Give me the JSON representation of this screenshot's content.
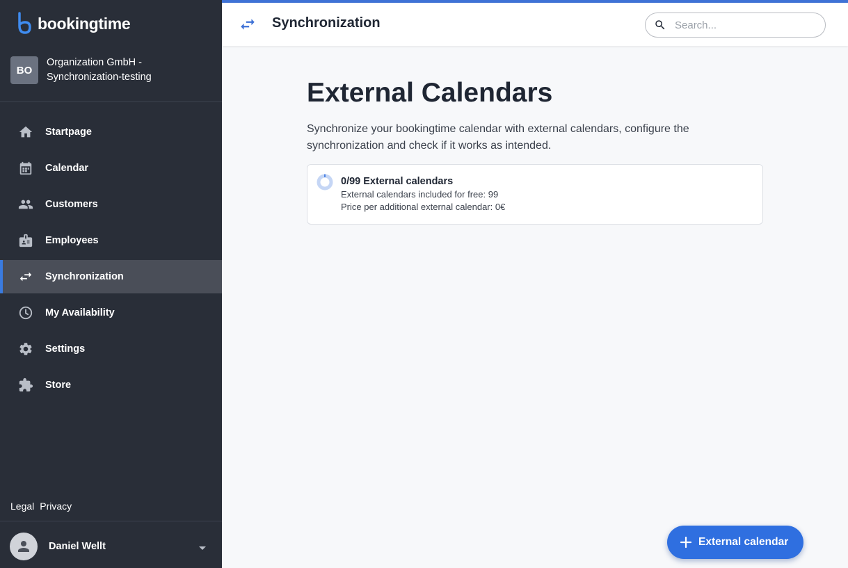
{
  "brand": {
    "name": "bookingtime",
    "logo_color": "#3f8cf0"
  },
  "organization": {
    "initials": "BO",
    "name_line1": "Organization GmbH -",
    "name_line2": "Synchronization-testing"
  },
  "nav": {
    "items": [
      {
        "label": "Startpage",
        "icon": "home-icon"
      },
      {
        "label": "Calendar",
        "icon": "calendar-icon"
      },
      {
        "label": "Customers",
        "icon": "people-icon"
      },
      {
        "label": "Employees",
        "icon": "badge-icon"
      },
      {
        "label": "Synchronization",
        "icon": "sync-icon",
        "active": true
      },
      {
        "label": "My Availability",
        "icon": "clock-icon"
      },
      {
        "label": "Settings",
        "icon": "gear-icon"
      },
      {
        "label": "Store",
        "icon": "puzzle-icon"
      }
    ]
  },
  "footer_links": {
    "legal": "Legal",
    "privacy": "Privacy"
  },
  "user": {
    "name": "Daniel Wellt"
  },
  "header": {
    "title": "Synchronization",
    "search_placeholder": "Search..."
  },
  "main": {
    "title": "External Calendars",
    "description": "Synchronize your bookingtime calendar with external calendars, configure the synchronization and check if it works as intended."
  },
  "quota_card": {
    "title": "0/99 External calendars",
    "free_line": "External calendars included for free: 99",
    "price_line": "Price per additional external calendar: 0€",
    "used": 0,
    "total": 99
  },
  "fab": {
    "label": "External calendar"
  },
  "colors": {
    "sidebar": "#292e38",
    "accent": "#3f72d6",
    "fab": "#2f6fe0",
    "active_item": "#4a4e58"
  }
}
